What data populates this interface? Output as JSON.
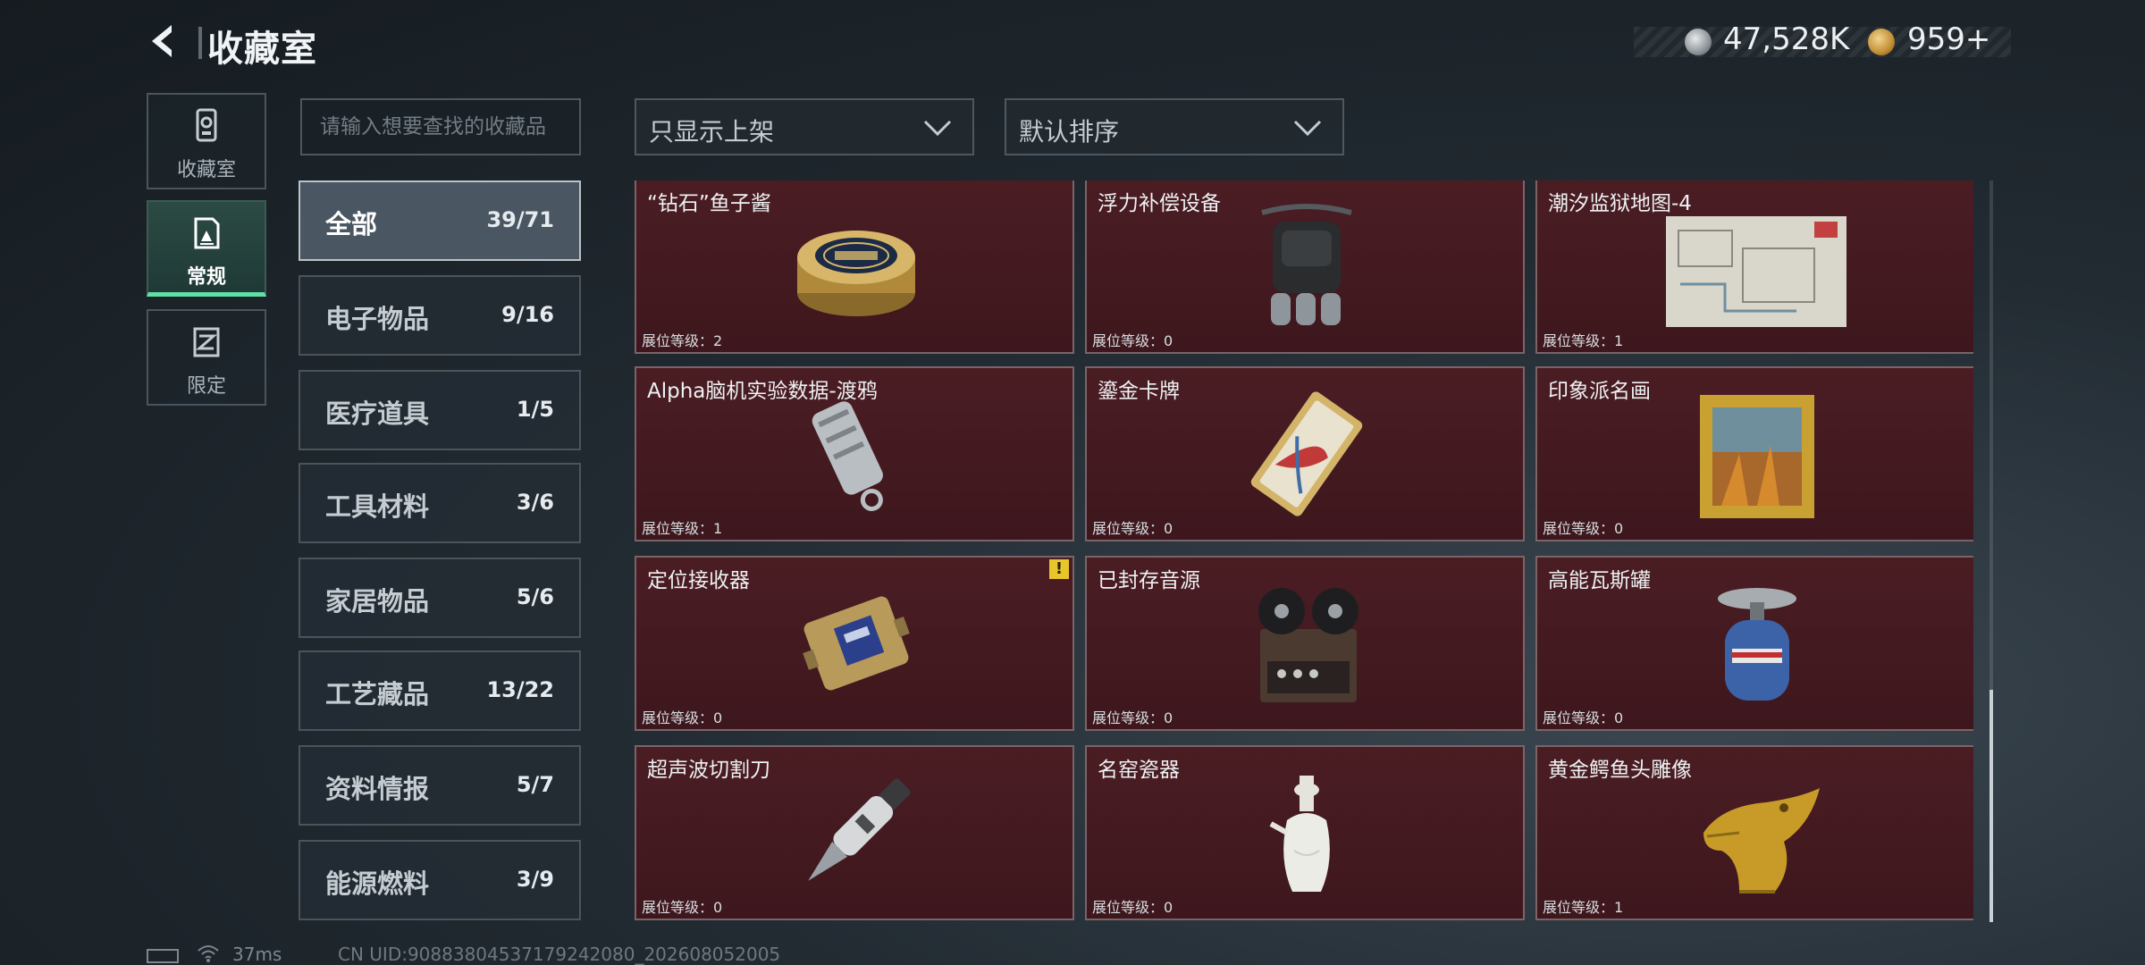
{
  "header": {
    "title": "收藏室",
    "currency_silver": "47,528K",
    "currency_gold": "959+"
  },
  "categories": [
    {
      "label": "收藏室",
      "icon": "vault-icon",
      "active": false
    },
    {
      "label": "常规",
      "icon": "frame-icon",
      "active": true
    },
    {
      "label": "限定",
      "icon": "limited-icon",
      "active": false
    }
  ],
  "search": {
    "placeholder": "请输入想要查找的收藏品"
  },
  "filters": {
    "display": "只显示上架",
    "sort": "默认排序"
  },
  "subcategories": [
    {
      "label": "全部",
      "count": "39/71"
    },
    {
      "label": "电子物品",
      "count": "9/16"
    },
    {
      "label": "医疗道具",
      "count": "1/5"
    },
    {
      "label": "工具材料",
      "count": "3/6"
    },
    {
      "label": "家居物品",
      "count": "5/6"
    },
    {
      "label": "工艺藏品",
      "count": "13/22"
    },
    {
      "label": "资料情报",
      "count": "5/7"
    },
    {
      "label": "能源燃料",
      "count": "3/9"
    }
  ],
  "items": [
    {
      "name": "“钻石”鱼子酱",
      "level": "展位等级：2",
      "icon": "caviar-tin-icon"
    },
    {
      "name": "浮力补偿设备",
      "level": "展位等级：0",
      "icon": "buoyancy-device-icon"
    },
    {
      "name": "潮汐监狱地图-4",
      "level": "展位等级：1",
      "icon": "prison-map-icon"
    },
    {
      "name": "Alpha脑机实验数据-渡鸦",
      "level": "展位等级：1",
      "icon": "data-drive-icon"
    },
    {
      "name": "鎏金卡牌",
      "level": "展位等级：0",
      "icon": "gilded-card-icon"
    },
    {
      "name": "印象派名画",
      "level": "展位等级：0",
      "icon": "painting-icon"
    },
    {
      "name": "定位接收器",
      "level": "展位等级：0",
      "icon": "locator-receiver-icon",
      "warning": "!"
    },
    {
      "name": "已封存音源",
      "level": "展位等级：0",
      "icon": "reel-recorder-icon"
    },
    {
      "name": "高能瓦斯罐",
      "level": "展位等级：0",
      "icon": "gas-canister-icon"
    },
    {
      "name": "超声波切割刀",
      "level": "展位等级：0",
      "icon": "ultrasonic-knife-icon"
    },
    {
      "name": "名窑瓷器",
      "level": "展位等级：0",
      "icon": "porcelain-vase-icon"
    },
    {
      "name": "黄金鳄鱼头雕像",
      "level": "展位等级：1",
      "icon": "crocodile-statue-icon"
    }
  ],
  "status": {
    "ping": "37ms",
    "uid": "CN UID:9088380453717924208​0_202608052005"
  },
  "colors": {
    "accent": "#5fe0a6",
    "card_bg": "#4a1d23",
    "warning": "#e8c52a"
  }
}
